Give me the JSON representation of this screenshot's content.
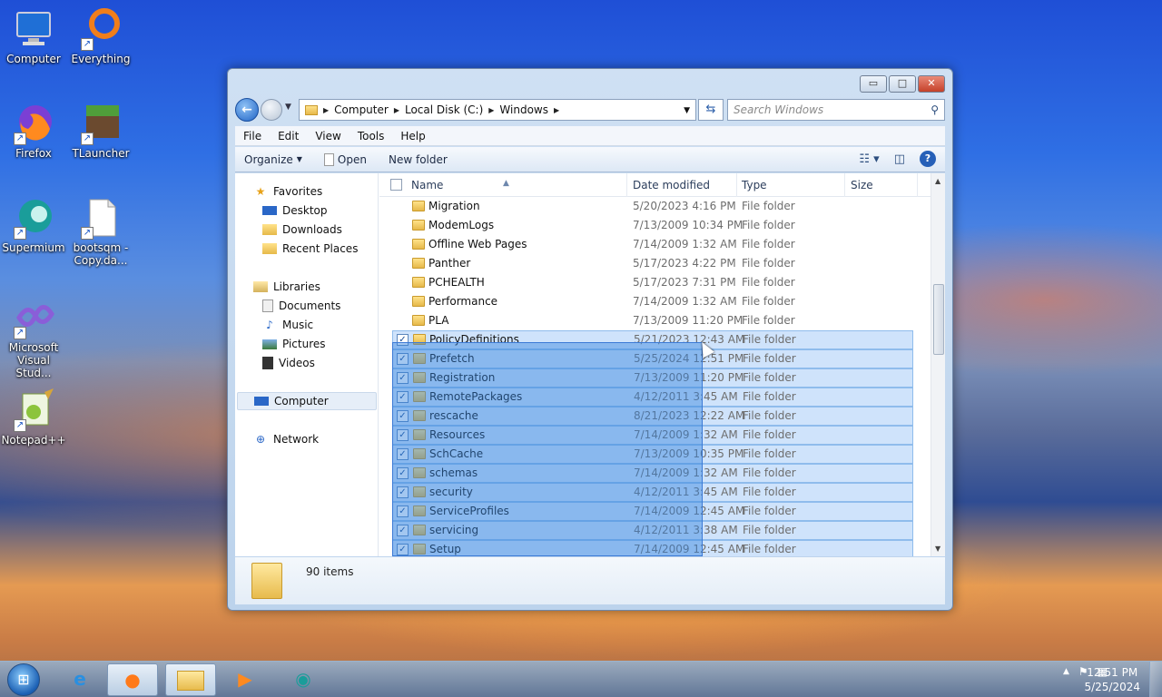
{
  "desktop": {
    "icons": [
      {
        "label": "Computer",
        "glyph": "🖥",
        "shortcut": false
      },
      {
        "label": "Everything",
        "glyph": "◯",
        "shortcut": true
      },
      {
        "label": "Firefox",
        "glyph": "🦊",
        "shortcut": true
      },
      {
        "label": "TLauncher",
        "glyph": "▣",
        "shortcut": true
      },
      {
        "label": "Supermium",
        "glyph": "◉",
        "shortcut": true
      },
      {
        "label": "bootsqm - Copy.da...",
        "glyph": "▭",
        "shortcut": true
      },
      {
        "label": "Microsoft Visual Stud...",
        "glyph": "∞",
        "shortcut": true
      },
      {
        "label": "Notepad++",
        "glyph": "✎",
        "shortcut": true
      }
    ]
  },
  "window": {
    "caption": {
      "minimize": "▭",
      "maximize": "□",
      "close": "✕"
    },
    "address": {
      "crumbs": [
        "Computer",
        "Local Disk (C:)",
        "Windows"
      ],
      "search_placeholder": "Search Windows"
    },
    "menu": [
      "File",
      "Edit",
      "View",
      "Tools",
      "Help"
    ],
    "toolbar": {
      "organize": "Organize",
      "open": "Open",
      "new_folder": "New folder"
    },
    "nav": {
      "favorites": "Favorites",
      "desktop": "Desktop",
      "downloads": "Downloads",
      "recent_places": "Recent Places",
      "libraries": "Libraries",
      "documents": "Documents",
      "music": "Music",
      "pictures": "Pictures",
      "videos": "Videos",
      "computer": "Computer",
      "network": "Network"
    },
    "columns": {
      "name": "Name",
      "date_modified": "Date modified",
      "type": "Type",
      "size": "Size"
    },
    "files": [
      {
        "name": "Migration",
        "date": "5/20/2023 4:16 PM",
        "type": "File folder",
        "selected": false
      },
      {
        "name": "ModemLogs",
        "date": "7/13/2009 10:34 PM",
        "type": "File folder",
        "selected": false
      },
      {
        "name": "Offline Web Pages",
        "date": "7/14/2009 1:32 AM",
        "type": "File folder",
        "selected": false
      },
      {
        "name": "Panther",
        "date": "5/17/2023 4:22 PM",
        "type": "File folder",
        "selected": false
      },
      {
        "name": "PCHEALTH",
        "date": "5/17/2023 7:31 PM",
        "type": "File folder",
        "selected": false
      },
      {
        "name": "Performance",
        "date": "7/14/2009 1:32 AM",
        "type": "File folder",
        "selected": false
      },
      {
        "name": "PLA",
        "date": "7/13/2009 11:20 PM",
        "type": "File folder",
        "selected": false
      },
      {
        "name": "PolicyDefinitions",
        "date": "5/21/2023 12:43 AM",
        "type": "File folder",
        "selected": true
      },
      {
        "name": "Prefetch",
        "date": "5/25/2024 12:51 PM",
        "type": "File folder",
        "selected": true
      },
      {
        "name": "Registration",
        "date": "7/13/2009 11:20 PM",
        "type": "File folder",
        "selected": true
      },
      {
        "name": "RemotePackages",
        "date": "4/12/2011 3:45 AM",
        "type": "File folder",
        "selected": true
      },
      {
        "name": "rescache",
        "date": "8/21/2023 12:22 AM",
        "type": "File folder",
        "selected": true
      },
      {
        "name": "Resources",
        "date": "7/14/2009 1:32 AM",
        "type": "File folder",
        "selected": true
      },
      {
        "name": "SchCache",
        "date": "7/13/2009 10:35 PM",
        "type": "File folder",
        "selected": true
      },
      {
        "name": "schemas",
        "date": "7/14/2009 1:32 AM",
        "type": "File folder",
        "selected": true
      },
      {
        "name": "security",
        "date": "4/12/2011 3:45 AM",
        "type": "File folder",
        "selected": true
      },
      {
        "name": "ServiceProfiles",
        "date": "7/14/2009 12:45 AM",
        "type": "File folder",
        "selected": true
      },
      {
        "name": "servicing",
        "date": "4/12/2011 3:38 AM",
        "type": "File folder",
        "selected": true
      },
      {
        "name": "Setup",
        "date": "7/14/2009 12:45 AM",
        "type": "File folder",
        "selected": true
      }
    ],
    "details": {
      "item_count": "90 items"
    }
  },
  "taskbar": {
    "clock_time": "12:51 PM",
    "clock_date": "5/25/2024"
  },
  "colors": {
    "selection": "#cfe3fb",
    "marquee": "#3382de",
    "accent": "#2660b8"
  }
}
